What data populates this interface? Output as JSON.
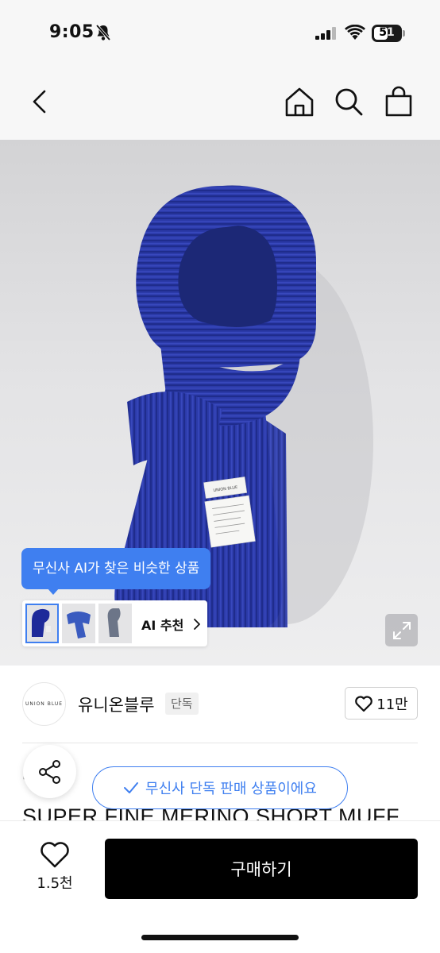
{
  "status_bar": {
    "time": "9:05",
    "battery": "51",
    "icons": [
      "bell-slash-icon",
      "cellular-signal-icon",
      "wifi-icon",
      "battery-icon"
    ]
  },
  "nav": {
    "icons": [
      "back-chevron-icon",
      "home-icon",
      "search-icon",
      "shopping-bag-icon"
    ]
  },
  "product_image": {
    "scarf_color": "#2b3aa8",
    "tag_brand_text": "UNION BLUE"
  },
  "ai_recommend": {
    "tooltip": "무신사 AI가 찾은 비슷한 상품",
    "label": "AI 추천",
    "accent": "#3f7ff0"
  },
  "brand": {
    "logo_text": "UNION BLUE",
    "name": "유니온블루",
    "badge": "단독",
    "like_count": "11만"
  },
  "content": {
    "category_peek": "머플",
    "title_peek": "SUPER FINE MERINO SHORT MUFF",
    "exclusive_notice": "무신사 단독 판매 상품이에요"
  },
  "bottom_bar": {
    "wish_count": "1.5천",
    "buy_label": "구매하기"
  }
}
